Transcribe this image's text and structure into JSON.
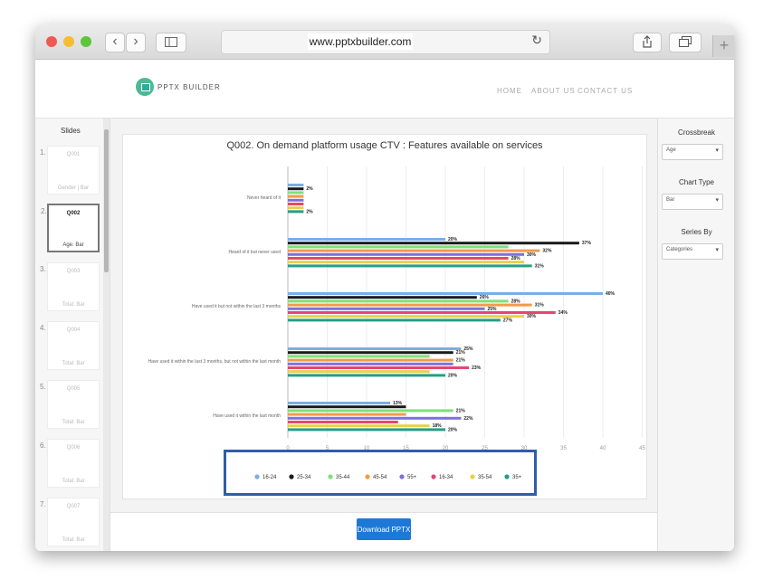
{
  "browser": {
    "url": "www.pptxbuilder.com"
  },
  "header": {
    "brand": "PPTX BUILDER",
    "nav": [
      "HOME",
      "ABOUT US",
      "CONTACT US"
    ]
  },
  "sidebar": {
    "title": "Slides",
    "slides": [
      {
        "num": "1.",
        "id": "Q001",
        "desc": "Gender | Bar"
      },
      {
        "num": "2.",
        "id": "Q002",
        "desc": "Age: Bar"
      },
      {
        "num": "3.",
        "id": "Q003",
        "desc": "Total: Bar"
      },
      {
        "num": "4.",
        "id": "Q004",
        "desc": "Total: Bar"
      },
      {
        "num": "5.",
        "id": "Q005",
        "desc": "Total: Bar"
      },
      {
        "num": "6.",
        "id": "Q006",
        "desc": "Total: Bar"
      },
      {
        "num": "7.",
        "id": "Q007",
        "desc": "Total: Bar"
      }
    ]
  },
  "panel": {
    "crossbreak_label": "Crossbreak",
    "crossbreak_value": "Age",
    "charttype_label": "Chart Type",
    "charttype_value": "Bar",
    "seriesby_label": "Series By",
    "seriesby_value": "Categories"
  },
  "main": {
    "download_label": "Download PPTX"
  },
  "colors": {
    "accent": "#1e78d6",
    "highlight": "#2f5ea9",
    "logo": "#4db894"
  },
  "chart_data": {
    "type": "bar",
    "orientation": "horizontal",
    "title": "Q002. On demand platform usage CTV : Features available on services",
    "categories": [
      "Never heard of it",
      "Heard of it but never used",
      "Have used it but not within the last 3 months",
      "Have used it within the last 3 months, but not within the last month",
      "Have used it within the last month"
    ],
    "series": [
      {
        "name": "16-24",
        "color": "#79aee8",
        "values": [
          2,
          20,
          40,
          22,
          13
        ]
      },
      {
        "name": "25-34",
        "color": "#1a1a1a",
        "values": [
          2,
          37,
          24,
          21,
          15
        ]
      },
      {
        "name": "35-44",
        "color": "#7ee07a",
        "values": [
          2,
          28,
          28,
          18,
          21
        ]
      },
      {
        "name": "45-54",
        "color": "#f29a4a",
        "values": [
          2,
          32,
          31,
          21,
          15
        ]
      },
      {
        "name": "55+",
        "color": "#7d70e0",
        "values": [
          2,
          30,
          25,
          21,
          22
        ]
      },
      {
        "name": "16-34",
        "color": "#e8456f",
        "values": [
          2,
          28,
          34,
          23,
          14
        ]
      },
      {
        "name": "35-54",
        "color": "#e8d04a",
        "values": [
          2,
          30,
          30,
          18,
          18
        ]
      },
      {
        "name": "35+",
        "color": "#249e86",
        "values": [
          2,
          31,
          27,
          20,
          20
        ]
      }
    ],
    "value_labels": [
      [
        "2%",
        "2%"
      ],
      [
        "20%",
        "37%",
        "32%",
        "30%",
        "28%",
        "31%"
      ],
      [
        "40%",
        "26%",
        "28%",
        "31%",
        "25%",
        "34%",
        "30%",
        "27%"
      ],
      [
        "25%",
        "21%",
        "21%",
        "23%",
        "20%"
      ],
      [
        "13%",
        "21%",
        "22%",
        "18%",
        "20%"
      ]
    ],
    "xticks": [
      "0",
      "5",
      "10",
      "15",
      "20",
      "25",
      "30",
      "35",
      "40",
      "45"
    ],
    "xlim": [
      0,
      45
    ],
    "grid": true,
    "legend_position": "bottom"
  }
}
